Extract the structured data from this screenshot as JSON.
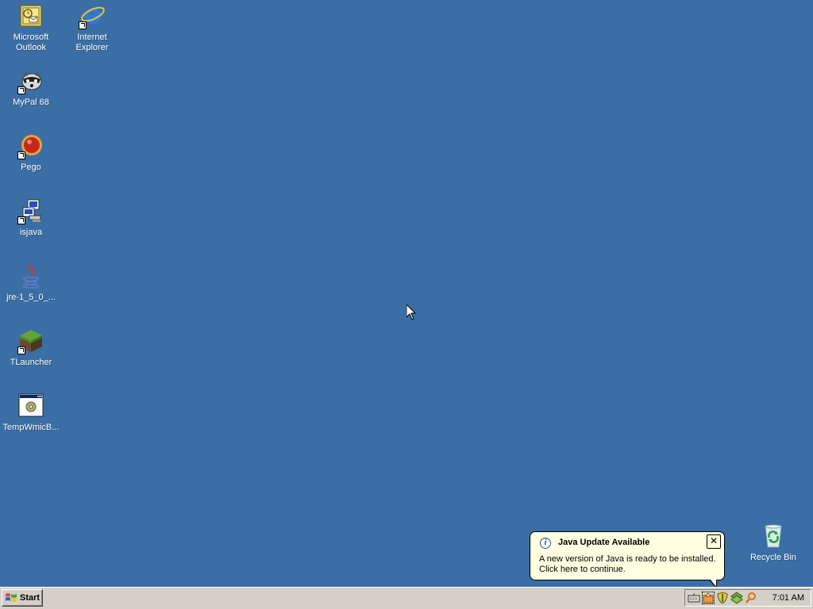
{
  "desktop": {
    "icons": [
      {
        "label": "Microsoft\nOutlook",
        "icon": "outlook-icon"
      },
      {
        "label": "Internet\nExplorer",
        "icon": "internet-explorer-icon"
      },
      {
        "label": "MyPal 68",
        "icon": "mypal-icon"
      },
      {
        "label": "Pego",
        "icon": "pego-icon"
      },
      {
        "label": "isjava",
        "icon": "isjava-icon"
      },
      {
        "label": "jre-1_5_0_...",
        "icon": "java-icon"
      },
      {
        "label": "TLauncher",
        "icon": "tlauncher-icon"
      },
      {
        "label": "TempWmicB...",
        "icon": "wmic-icon"
      },
      {
        "label": "Recycle Bin",
        "icon": "recycle-bin-icon"
      }
    ],
    "background": "#3A6EA5"
  },
  "taskbar": {
    "start_label": "Start",
    "clock": "7:01 AM",
    "tray_icons": [
      "keyboard-icon",
      "java-update-icon",
      "security-shield-icon",
      "network-icon",
      "search-icon"
    ]
  },
  "balloon": {
    "title": "Java Update Available",
    "text": "A new version of Java is ready to be installed.\nClick here to continue.",
    "close_glyph": "✕"
  }
}
